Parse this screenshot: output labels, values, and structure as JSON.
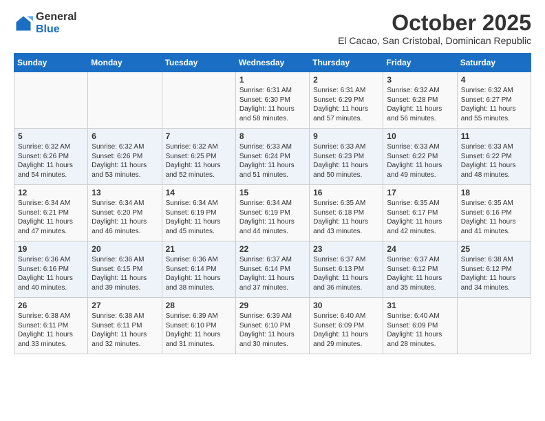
{
  "logo": {
    "general": "General",
    "blue": "Blue"
  },
  "header": {
    "month": "October 2025",
    "location": "El Cacao, San Cristobal, Dominican Republic"
  },
  "weekdays": [
    "Sunday",
    "Monday",
    "Tuesday",
    "Wednesday",
    "Thursday",
    "Friday",
    "Saturday"
  ],
  "weeks": [
    [
      {
        "day": "",
        "info": ""
      },
      {
        "day": "",
        "info": ""
      },
      {
        "day": "",
        "info": ""
      },
      {
        "day": "1",
        "info": "Sunrise: 6:31 AM\nSunset: 6:30 PM\nDaylight: 11 hours and 58 minutes."
      },
      {
        "day": "2",
        "info": "Sunrise: 6:31 AM\nSunset: 6:29 PM\nDaylight: 11 hours and 57 minutes."
      },
      {
        "day": "3",
        "info": "Sunrise: 6:32 AM\nSunset: 6:28 PM\nDaylight: 11 hours and 56 minutes."
      },
      {
        "day": "4",
        "info": "Sunrise: 6:32 AM\nSunset: 6:27 PM\nDaylight: 11 hours and 55 minutes."
      }
    ],
    [
      {
        "day": "5",
        "info": "Sunrise: 6:32 AM\nSunset: 6:26 PM\nDaylight: 11 hours and 54 minutes."
      },
      {
        "day": "6",
        "info": "Sunrise: 6:32 AM\nSunset: 6:26 PM\nDaylight: 11 hours and 53 minutes."
      },
      {
        "day": "7",
        "info": "Sunrise: 6:32 AM\nSunset: 6:25 PM\nDaylight: 11 hours and 52 minutes."
      },
      {
        "day": "8",
        "info": "Sunrise: 6:33 AM\nSunset: 6:24 PM\nDaylight: 11 hours and 51 minutes."
      },
      {
        "day": "9",
        "info": "Sunrise: 6:33 AM\nSunset: 6:23 PM\nDaylight: 11 hours and 50 minutes."
      },
      {
        "day": "10",
        "info": "Sunrise: 6:33 AM\nSunset: 6:22 PM\nDaylight: 11 hours and 49 minutes."
      },
      {
        "day": "11",
        "info": "Sunrise: 6:33 AM\nSunset: 6:22 PM\nDaylight: 11 hours and 48 minutes."
      }
    ],
    [
      {
        "day": "12",
        "info": "Sunrise: 6:34 AM\nSunset: 6:21 PM\nDaylight: 11 hours and 47 minutes."
      },
      {
        "day": "13",
        "info": "Sunrise: 6:34 AM\nSunset: 6:20 PM\nDaylight: 11 hours and 46 minutes."
      },
      {
        "day": "14",
        "info": "Sunrise: 6:34 AM\nSunset: 6:19 PM\nDaylight: 11 hours and 45 minutes."
      },
      {
        "day": "15",
        "info": "Sunrise: 6:34 AM\nSunset: 6:19 PM\nDaylight: 11 hours and 44 minutes."
      },
      {
        "day": "16",
        "info": "Sunrise: 6:35 AM\nSunset: 6:18 PM\nDaylight: 11 hours and 43 minutes."
      },
      {
        "day": "17",
        "info": "Sunrise: 6:35 AM\nSunset: 6:17 PM\nDaylight: 11 hours and 42 minutes."
      },
      {
        "day": "18",
        "info": "Sunrise: 6:35 AM\nSunset: 6:16 PM\nDaylight: 11 hours and 41 minutes."
      }
    ],
    [
      {
        "day": "19",
        "info": "Sunrise: 6:36 AM\nSunset: 6:16 PM\nDaylight: 11 hours and 40 minutes."
      },
      {
        "day": "20",
        "info": "Sunrise: 6:36 AM\nSunset: 6:15 PM\nDaylight: 11 hours and 39 minutes."
      },
      {
        "day": "21",
        "info": "Sunrise: 6:36 AM\nSunset: 6:14 PM\nDaylight: 11 hours and 38 minutes."
      },
      {
        "day": "22",
        "info": "Sunrise: 6:37 AM\nSunset: 6:14 PM\nDaylight: 11 hours and 37 minutes."
      },
      {
        "day": "23",
        "info": "Sunrise: 6:37 AM\nSunset: 6:13 PM\nDaylight: 11 hours and 36 minutes."
      },
      {
        "day": "24",
        "info": "Sunrise: 6:37 AM\nSunset: 6:12 PM\nDaylight: 11 hours and 35 minutes."
      },
      {
        "day": "25",
        "info": "Sunrise: 6:38 AM\nSunset: 6:12 PM\nDaylight: 11 hours and 34 minutes."
      }
    ],
    [
      {
        "day": "26",
        "info": "Sunrise: 6:38 AM\nSunset: 6:11 PM\nDaylight: 11 hours and 33 minutes."
      },
      {
        "day": "27",
        "info": "Sunrise: 6:38 AM\nSunset: 6:11 PM\nDaylight: 11 hours and 32 minutes."
      },
      {
        "day": "28",
        "info": "Sunrise: 6:39 AM\nSunset: 6:10 PM\nDaylight: 11 hours and 31 minutes."
      },
      {
        "day": "29",
        "info": "Sunrise: 6:39 AM\nSunset: 6:10 PM\nDaylight: 11 hours and 30 minutes."
      },
      {
        "day": "30",
        "info": "Sunrise: 6:40 AM\nSunset: 6:09 PM\nDaylight: 11 hours and 29 minutes."
      },
      {
        "day": "31",
        "info": "Sunrise: 6:40 AM\nSunset: 6:09 PM\nDaylight: 11 hours and 28 minutes."
      },
      {
        "day": "",
        "info": ""
      }
    ]
  ]
}
